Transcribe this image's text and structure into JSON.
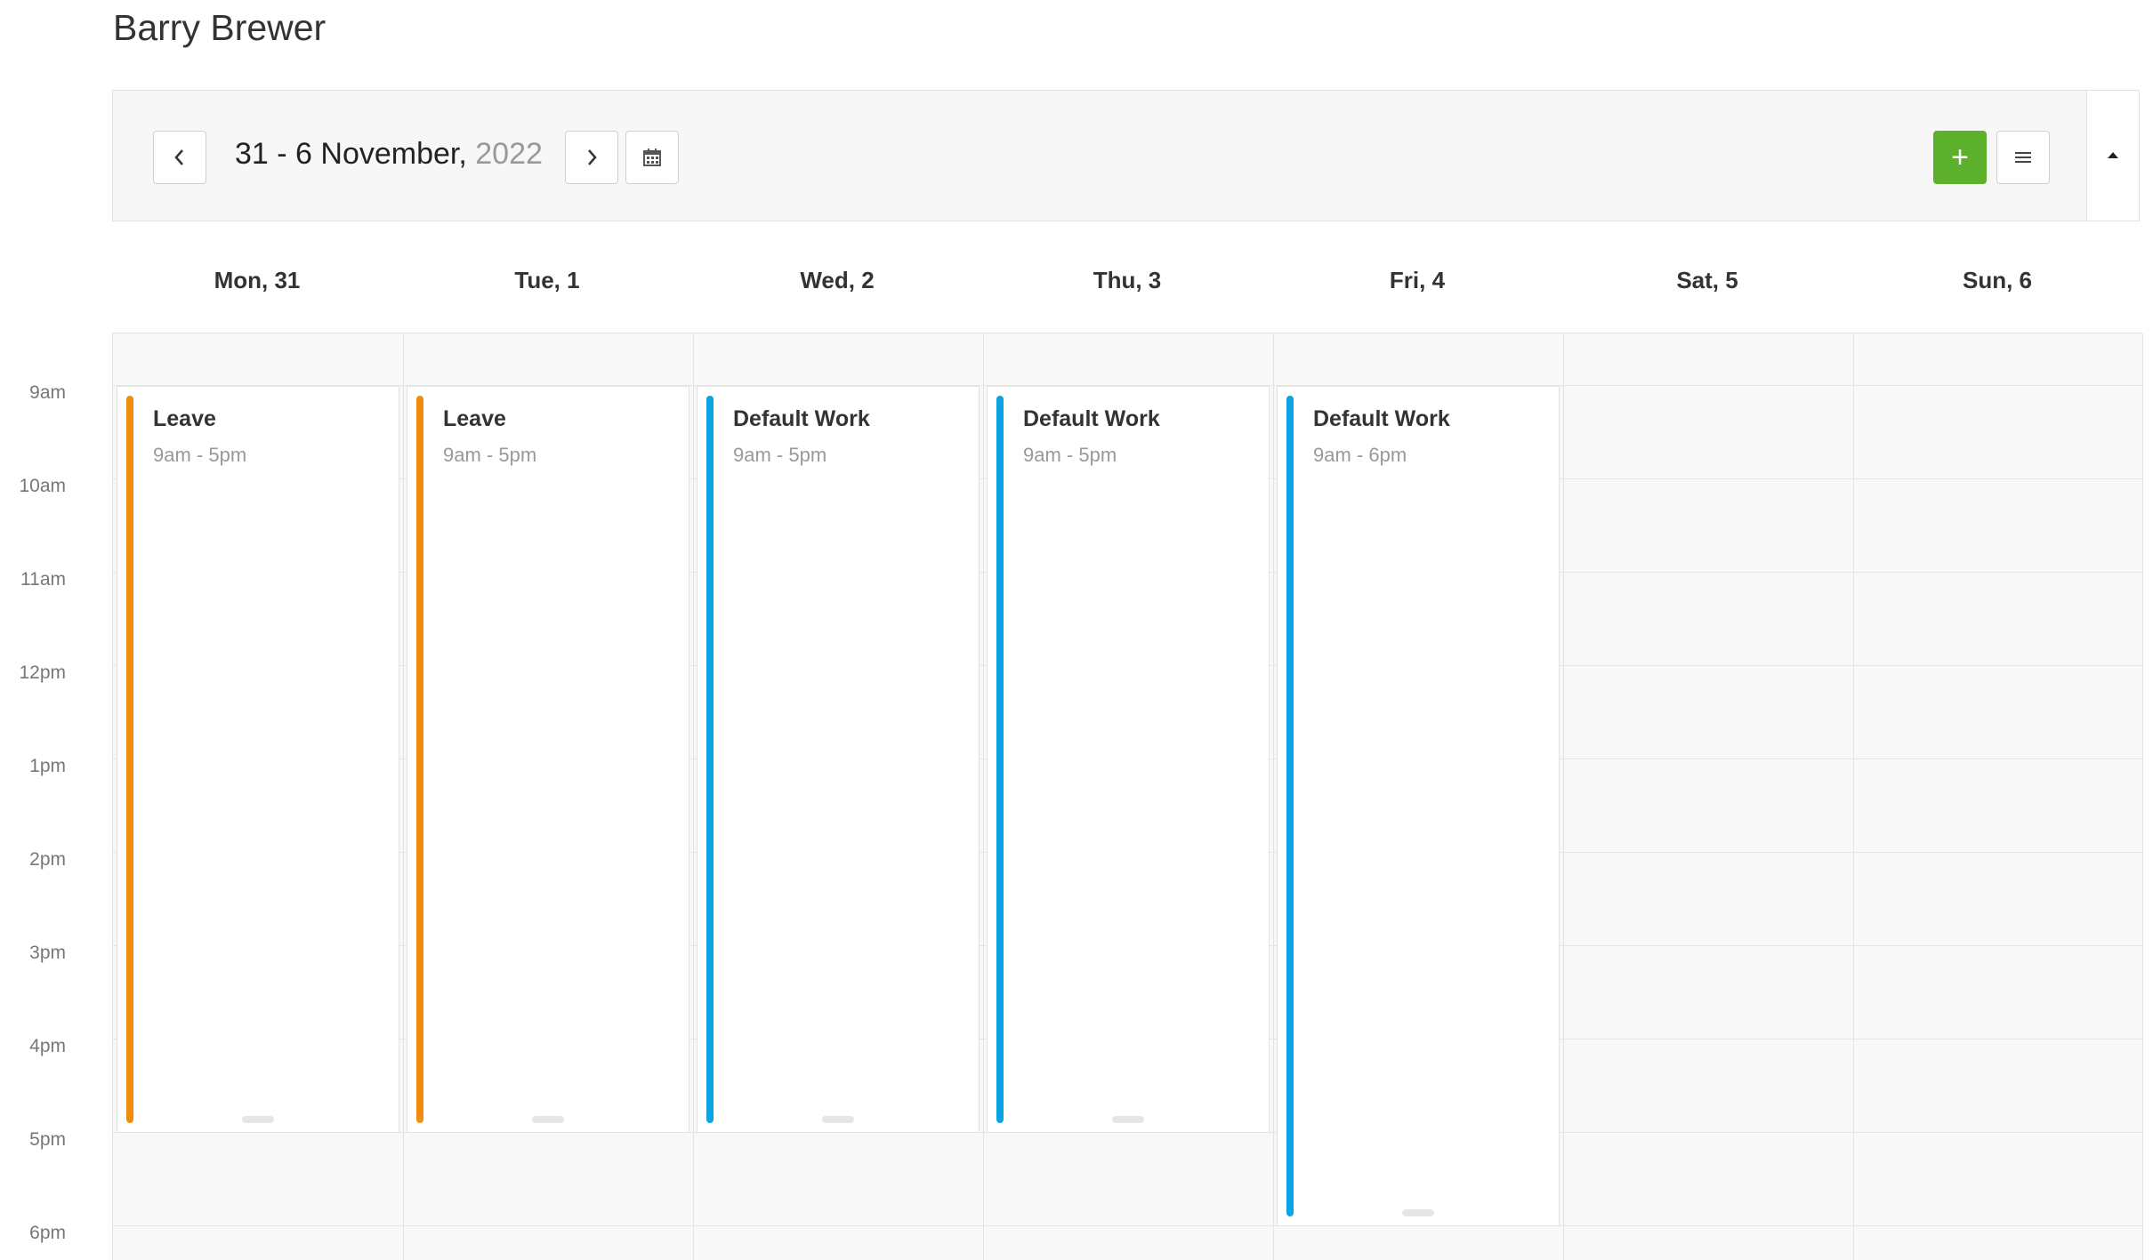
{
  "page": {
    "title": "Barry Brewer"
  },
  "toolbar": {
    "range_text": "31 - 6 November,",
    "range_year": "2022",
    "add_label": "+",
    "accent_color": "#5cb02c"
  },
  "days": [
    {
      "label": "Mon, 31"
    },
    {
      "label": "Tue, 1"
    },
    {
      "label": "Wed, 2"
    },
    {
      "label": "Thu, 3"
    },
    {
      "label": "Fri, 4"
    },
    {
      "label": "Sat, 5"
    },
    {
      "label": "Sun, 6"
    }
  ],
  "times": [
    "9am",
    "10am",
    "11am",
    "12pm",
    "1pm",
    "2pm",
    "3pm",
    "4pm",
    "5pm",
    "6pm"
  ],
  "events": [
    {
      "title": "Leave",
      "time": "9am - 5pm",
      "color": "#f28c0f"
    },
    {
      "title": "Leave",
      "time": "9am - 5pm",
      "color": "#f28c0f"
    },
    {
      "title": "Default Work",
      "time": "9am - 5pm",
      "color": "#0aa3e4"
    },
    {
      "title": "Default Work",
      "time": "9am - 5pm",
      "color": "#0aa3e4"
    },
    {
      "title": "Default Work",
      "time": "9am - 6pm",
      "color": "#0aa3e4"
    }
  ]
}
